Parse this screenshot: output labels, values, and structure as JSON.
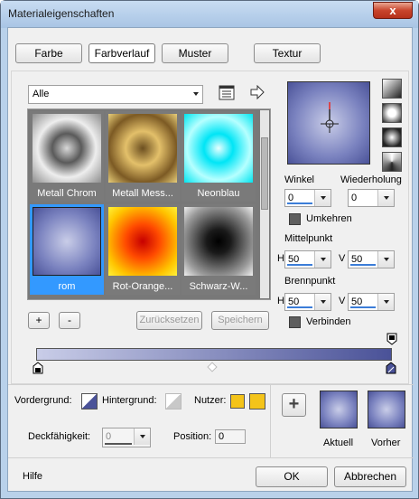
{
  "window": {
    "title": "Materialeigenschaften",
    "close_symbol": "x"
  },
  "tabs": [
    "Farbe",
    "Farbverlauf",
    "Muster",
    "Textur"
  ],
  "library": {
    "category": "Alle",
    "items": [
      "Metall Chrom",
      "Metall Mess...",
      "Neonblau",
      "rom",
      "Rot-Orange...",
      "Schwarz-W..."
    ],
    "selected": "rom"
  },
  "gradient_buttons": {
    "add": "+",
    "remove": "-",
    "reset": "Zurücksetzen",
    "save": "Speichern"
  },
  "angle": {
    "label": "Winkel",
    "value": "0"
  },
  "repeat": {
    "label": "Wiederholung",
    "value": "0"
  },
  "invert": {
    "label": "Umkehren"
  },
  "center": {
    "label": "Mittelpunkt",
    "h": "50",
    "v": "50",
    "h_label": "H",
    "v_label": "V"
  },
  "focus": {
    "label": "Brennpunkt",
    "h": "50",
    "v": "50",
    "h_label": "H",
    "v_label": "V"
  },
  "link": {
    "label": "Verbinden"
  },
  "stops": {
    "foreground_label": "Vordergrund:",
    "background_label": "Hintergrund:",
    "user_label": "Nutzer:",
    "opacity_label": "Deckfähigkeit:",
    "opacity_value": "0",
    "position_label": "Position:",
    "position_value": "0"
  },
  "preview": {
    "add": "+",
    "current_label": "Aktuell",
    "previous_label": "Vorher"
  },
  "footer": {
    "help": "Hilfe",
    "ok": "OK",
    "cancel": "Abbrechen"
  },
  "colors": {
    "gradient_dark": "#4a5298",
    "gradient_light": "#c9cde8",
    "user_color": "#f4c41a",
    "selection": "#3399ff"
  }
}
